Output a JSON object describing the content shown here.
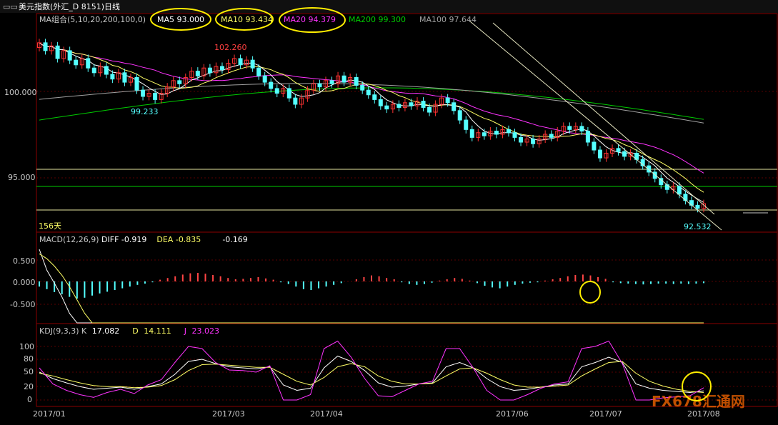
{
  "window": {
    "title": "美元指数(外汇_D 8151)日线"
  },
  "colors": {
    "background": "#000000",
    "frame": "#8b0000",
    "candle_up": "#ff3232",
    "candle_down": "#54ffff",
    "ma5": "#ffffff",
    "ma10": "#ffff66",
    "ma20": "#ff33ff",
    "ma200": "#00cc00",
    "ma100": "#a0a0a0",
    "macd_up": "#ff4444",
    "macd_down": "#54ffff",
    "kdj_k": "#ffffff",
    "kdj_d": "#ffff66",
    "kdj_j": "#ff33ff",
    "annotation": "#ffee00"
  },
  "price_panel": {
    "indicator_label": "MA组合(5,10,20,200,100,0)",
    "legend": [
      {
        "name": "MA5",
        "value": "93.000"
      },
      {
        "name": "MA10",
        "value": "93.434"
      },
      {
        "name": "MA20",
        "value": "94.379"
      },
      {
        "name": "MA200",
        "value": "99.300"
      },
      {
        "name": "MA100",
        "value": "97.644"
      }
    ],
    "y_ticks": [
      "100.000",
      "95.000"
    ],
    "high_label": "102.260",
    "low_label": "99.233",
    "last_label": "92.532",
    "days_label": "156天"
  },
  "macd_panel": {
    "label": "MACD(12,26,9)",
    "diff_label": "DIFF",
    "diff_value": "-0.919",
    "dea_label": "DEA",
    "dea_value": "-0.835",
    "macd_value": "-0.169",
    "y_ticks": [
      "0.500",
      "0.000",
      "-0.500"
    ]
  },
  "kdj_panel": {
    "label": "KDJ(9,3,3)",
    "k_label": "K",
    "k_value": "17.082",
    "d_label": "D",
    "d_value": "14.111",
    "j_label": "J",
    "j_value": "23.023",
    "y_ticks": [
      "100",
      "80",
      "50",
      "20",
      "0"
    ]
  },
  "x_axis": {
    "ticks": [
      "2017/01",
      "2017/03",
      "2017/04",
      "2017/06",
      "2017/07",
      "2017/08"
    ]
  },
  "watermark": "FX678汇通网",
  "chart_data": [
    {
      "type": "candlestick",
      "title": "美元指数(外汇_D 8151)日线",
      "ylim": [
        92,
        104
      ],
      "candles": [
        {
          "o": 102.8,
          "c": 103.1
        },
        {
          "o": 103.1,
          "c": 102.6
        },
        {
          "o": 102.6,
          "c": 102.9
        },
        {
          "o": 102.9,
          "c": 102.1
        },
        {
          "o": 102.1,
          "c": 102.6
        },
        {
          "o": 102.6,
          "c": 102.0
        },
        {
          "o": 102.0,
          "c": 101.7
        },
        {
          "o": 101.7,
          "c": 102.1
        },
        {
          "o": 102.1,
          "c": 101.5
        },
        {
          "o": 101.5,
          "c": 101.2
        },
        {
          "o": 101.2,
          "c": 101.6
        },
        {
          "o": 101.6,
          "c": 101.1
        },
        {
          "o": 101.1,
          "c": 100.8
        },
        {
          "o": 100.8,
          "c": 101.2
        },
        {
          "o": 101.2,
          "c": 100.6
        },
        {
          "o": 100.6,
          "c": 100.9
        },
        {
          "o": 100.9,
          "c": 100.1
        },
        {
          "o": 100.1,
          "c": 99.7
        },
        {
          "o": 99.7,
          "c": 99.9
        },
        {
          "o": 99.9,
          "c": 99.5
        },
        {
          "o": 99.5,
          "c": 99.9
        },
        {
          "o": 99.9,
          "c": 100.3
        },
        {
          "o": 100.3,
          "c": 100.7
        },
        {
          "o": 100.7,
          "c": 100.5
        },
        {
          "o": 100.5,
          "c": 100.9
        },
        {
          "o": 100.9,
          "c": 101.3
        },
        {
          "o": 101.3,
          "c": 101.0
        },
        {
          "o": 101.0,
          "c": 101.5
        },
        {
          "o": 101.5,
          "c": 101.2
        },
        {
          "o": 101.2,
          "c": 101.6
        },
        {
          "o": 101.6,
          "c": 101.4
        },
        {
          "o": 101.4,
          "c": 101.8
        },
        {
          "o": 101.8,
          "c": 102.1
        },
        {
          "o": 102.1,
          "c": 101.7
        },
        {
          "o": 101.7,
          "c": 102.0
        },
        {
          "o": 102.0,
          "c": 101.5
        },
        {
          "o": 101.5,
          "c": 101.0
        },
        {
          "o": 101.0,
          "c": 100.6
        },
        {
          "o": 100.6,
          "c": 100.2
        },
        {
          "o": 100.2,
          "c": 99.9
        },
        {
          "o": 99.9,
          "c": 100.2
        },
        {
          "o": 100.2,
          "c": 99.6
        },
        {
          "o": 99.6,
          "c": 99.2
        },
        {
          "o": 99.2,
          "c": 99.6
        },
        {
          "o": 99.6,
          "c": 100.1
        },
        {
          "o": 100.1,
          "c": 100.5
        },
        {
          "o": 100.5,
          "c": 100.3
        },
        {
          "o": 100.3,
          "c": 100.7
        },
        {
          "o": 100.7,
          "c": 100.5
        },
        {
          "o": 100.5,
          "c": 101.0
        },
        {
          "o": 101.0,
          "c": 100.6
        },
        {
          "o": 100.6,
          "c": 100.9
        },
        {
          "o": 100.9,
          "c": 100.4
        },
        {
          "o": 100.4,
          "c": 100.1
        },
        {
          "o": 100.1,
          "c": 99.8
        },
        {
          "o": 99.8,
          "c": 99.5
        },
        {
          "o": 99.5,
          "c": 99.1
        },
        {
          "o": 99.1,
          "c": 98.9
        },
        {
          "o": 98.9,
          "c": 99.2
        },
        {
          "o": 99.2,
          "c": 99.0
        },
        {
          "o": 99.0,
          "c": 99.3
        },
        {
          "o": 99.3,
          "c": 99.1
        },
        {
          "o": 99.1,
          "c": 99.4
        },
        {
          "o": 99.4,
          "c": 99.0
        },
        {
          "o": 99.0,
          "c": 98.7
        },
        {
          "o": 98.7,
          "c": 99.2
        },
        {
          "o": 99.2,
          "c": 99.6
        },
        {
          "o": 99.6,
          "c": 99.3
        },
        {
          "o": 99.3,
          "c": 98.8
        },
        {
          "o": 98.8,
          "c": 98.2
        },
        {
          "o": 98.2,
          "c": 97.6
        },
        {
          "o": 97.6,
          "c": 97.1
        },
        {
          "o": 97.1,
          "c": 97.4
        },
        {
          "o": 97.4,
          "c": 97.2
        },
        {
          "o": 97.2,
          "c": 97.5
        },
        {
          "o": 97.5,
          "c": 97.3
        },
        {
          "o": 97.3,
          "c": 97.6
        },
        {
          "o": 97.6,
          "c": 97.4
        },
        {
          "o": 97.4,
          "c": 97.1
        },
        {
          "o": 97.1,
          "c": 96.8
        },
        {
          "o": 96.8,
          "c": 97.0
        },
        {
          "o": 97.0,
          "c": 96.7
        },
        {
          "o": 96.7,
          "c": 97.0
        },
        {
          "o": 97.0,
          "c": 97.3
        },
        {
          "o": 97.3,
          "c": 97.1
        },
        {
          "o": 97.1,
          "c": 97.5
        },
        {
          "o": 97.5,
          "c": 97.8
        },
        {
          "o": 97.8,
          "c": 97.6
        },
        {
          "o": 97.6,
          "c": 97.8
        },
        {
          "o": 97.8,
          "c": 97.5
        },
        {
          "o": 97.5,
          "c": 96.8
        },
        {
          "o": 96.8,
          "c": 96.3
        },
        {
          "o": 96.3,
          "c": 95.8
        },
        {
          "o": 95.8,
          "c": 96.1
        },
        {
          "o": 96.1,
          "c": 96.4
        },
        {
          "o": 96.4,
          "c": 96.2
        },
        {
          "o": 96.2,
          "c": 95.9
        },
        {
          "o": 95.9,
          "c": 96.1
        },
        {
          "o": 96.1,
          "c": 95.7
        },
        {
          "o": 95.7,
          "c": 95.3
        },
        {
          "o": 95.3,
          "c": 94.9
        },
        {
          "o": 94.9,
          "c": 94.5
        },
        {
          "o": 94.5,
          "c": 94.1
        },
        {
          "o": 94.1,
          "c": 93.8
        },
        {
          "o": 93.8,
          "c": 94.0
        },
        {
          "o": 94.0,
          "c": 93.5
        },
        {
          "o": 93.5,
          "c": 93.1
        },
        {
          "o": 93.1,
          "c": 92.8
        },
        {
          "o": 92.8,
          "c": 92.6
        },
        {
          "o": 92.6,
          "c": 92.9
        }
      ],
      "high": 102.26,
      "low": 92.532
    },
    {
      "type": "bar",
      "title": "MACD(12,26,9)",
      "ylim": [
        -1.0,
        1.0
      ],
      "values": [
        -0.12,
        -0.18,
        -0.25,
        -0.3,
        -0.36,
        -0.4,
        -0.38,
        -0.33,
        -0.28,
        -0.24,
        -0.2,
        -0.16,
        -0.12,
        -0.08,
        -0.05,
        -0.02,
        0.04,
        0.08,
        0.12,
        0.16,
        0.19,
        0.2,
        0.18,
        0.15,
        0.12,
        0.08,
        0.05,
        0.06,
        0.08,
        0.1,
        0.07,
        0.04,
        -0.02,
        -0.06,
        -0.12,
        -0.18,
        -0.2,
        -0.16,
        -0.12,
        -0.08,
        -0.04,
        0.0,
        0.05,
        0.1,
        0.14,
        0.12,
        0.08,
        0.05,
        -0.02,
        -0.06,
        -0.08,
        -0.06,
        -0.03,
        0.02,
        0.05,
        0.08,
        0.06,
        0.02,
        -0.04,
        -0.1,
        -0.14,
        -0.16,
        -0.12,
        -0.08,
        -0.05,
        -0.03,
        -0.02,
        0.02,
        0.05,
        0.08,
        0.12,
        0.15,
        0.16,
        0.14,
        0.1,
        0.06,
        -0.02,
        -0.04,
        -0.05,
        -0.06,
        -0.07,
        -0.06,
        -0.05,
        -0.05,
        -0.06,
        -0.05,
        -0.06,
        -0.05,
        -0.04
      ]
    },
    {
      "type": "line",
      "title": "KDJ(9,3,3)",
      "ylim": [
        0,
        100
      ],
      "series": [
        {
          "name": "K",
          "values": [
            52,
            40,
            32,
            25,
            20,
            22,
            24,
            20,
            25,
            30,
            48,
            72,
            76,
            68,
            62,
            60,
            58,
            62,
            28,
            18,
            22,
            60,
            82,
            72,
            55,
            32,
            24,
            26,
            30,
            32,
            62,
            70,
            60,
            40,
            25,
            18,
            20,
            24,
            28,
            30,
            62,
            70,
            80,
            70,
            30,
            22,
            18,
            16,
            14,
            17
          ]
        },
        {
          "name": "D",
          "values": [
            50,
            45,
            38,
            32,
            27,
            25,
            25,
            23,
            24,
            27,
            38,
            55,
            66,
            67,
            65,
            63,
            61,
            61,
            48,
            35,
            28,
            42,
            62,
            68,
            62,
            45,
            35,
            30,
            30,
            31,
            45,
            58,
            60,
            50,
            38,
            28,
            24,
            24,
            26,
            28,
            45,
            58,
            70,
            72,
            50,
            35,
            26,
            20,
            16,
            14
          ]
        },
        {
          "name": "J",
          "values": [
            60,
            30,
            18,
            10,
            5,
            14,
            20,
            12,
            28,
            38,
            70,
            100,
            96,
            70,
            56,
            55,
            52,
            64,
            0,
            0,
            10,
            96,
            110,
            80,
            40,
            8,
            6,
            18,
            30,
            35,
            96,
            96,
            60,
            18,
            0,
            0,
            10,
            22,
            30,
            34,
            96,
            100,
            110,
            68,
            0,
            0,
            4,
            6,
            8,
            23
          ]
        }
      ]
    }
  ]
}
